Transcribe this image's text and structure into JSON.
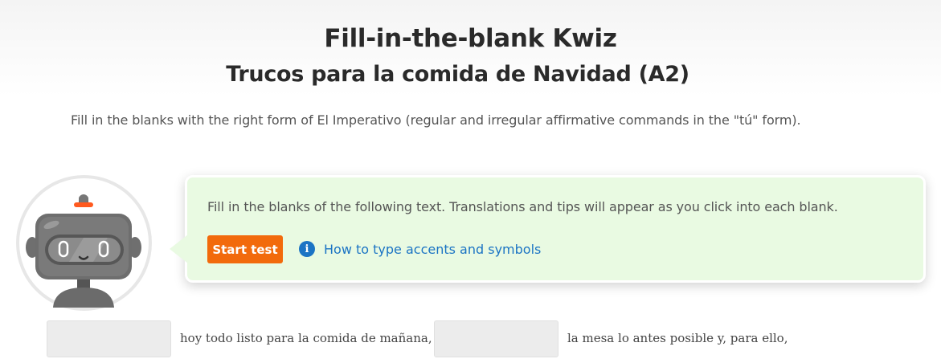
{
  "header": {
    "title": "Fill-in-the-blank Kwiz",
    "subtitle": "Trucos para la comida de Navidad (A2)"
  },
  "instructions": "Fill in the blanks with the right form of El Imperativo (regular and irregular affirmative commands in the \"tú\" form).",
  "callout": {
    "text": "Fill in the blanks of the following text. Translations and tips will appear as you click into each blank.",
    "start_label": "Start test",
    "help_link_label": "How to type accents and symbols",
    "info_icon_glyph": "i"
  },
  "exercise": {
    "segments": [
      "hoy todo listo para la comida de mañana,",
      "la mesa lo antes posible  y, para ello,"
    ],
    "blanks": [
      "",
      ""
    ]
  },
  "colors": {
    "accent_orange": "#f26a0c",
    "link_blue": "#1b74c4",
    "callout_bg": "#e9fae2"
  }
}
